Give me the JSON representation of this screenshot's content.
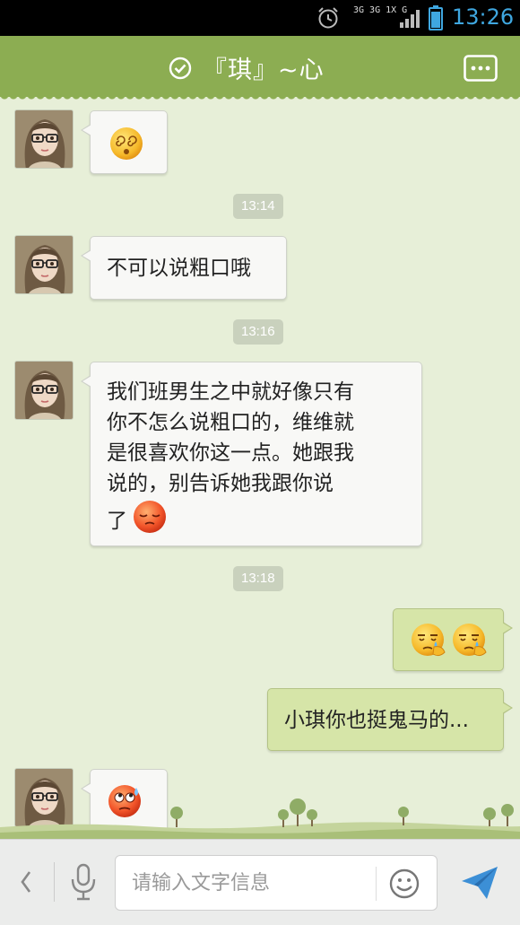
{
  "status_bar": {
    "network_label": "3G 3G 1X G",
    "time": "13:26",
    "icons": [
      "alarm-icon",
      "signal-icon",
      "battery-icon"
    ],
    "time_color": "#3fa7e0"
  },
  "header": {
    "title": "『琪』~心",
    "icons": [
      "check-circle-icon",
      "more-icon"
    ],
    "bg_color": "#8cad52"
  },
  "messages": [
    {
      "side": "in",
      "type": "emoji",
      "emoji": "dizzy-face"
    },
    {
      "side": "time",
      "text": "13:14"
    },
    {
      "side": "in",
      "type": "text",
      "text": "不可以说粗口哦"
    },
    {
      "side": "time",
      "text": "13:16"
    },
    {
      "side": "in",
      "type": "text",
      "lines": [
        "我们班男生之中就好像只有",
        "你不怎么说粗口的，维维就",
        "是很喜欢你这一点。她跟我",
        "说的，别告诉她我跟你说",
        "了"
      ],
      "trailing_emoji": "blushing-face"
    },
    {
      "side": "time",
      "text": "13:18"
    },
    {
      "side": "out",
      "type": "emoji",
      "emojis": [
        "wiping-tears-face",
        "wiping-tears-face"
      ]
    },
    {
      "side": "out",
      "type": "text",
      "text": "小琪你也挺鬼马的..."
    },
    {
      "side": "in",
      "type": "emoji",
      "emoji": "rolling-eyes-sweat-face"
    }
  ],
  "input_bar": {
    "placeholder": "请输入文字信息",
    "icons": [
      "back-arrow-icon",
      "microphone-icon",
      "smiley-icon",
      "send-icon"
    ]
  },
  "colors": {
    "chat_bg": "#e7efd8",
    "incoming_bubble": "#f8f8f6",
    "outgoing_bubble": "#d6e5a8"
  }
}
